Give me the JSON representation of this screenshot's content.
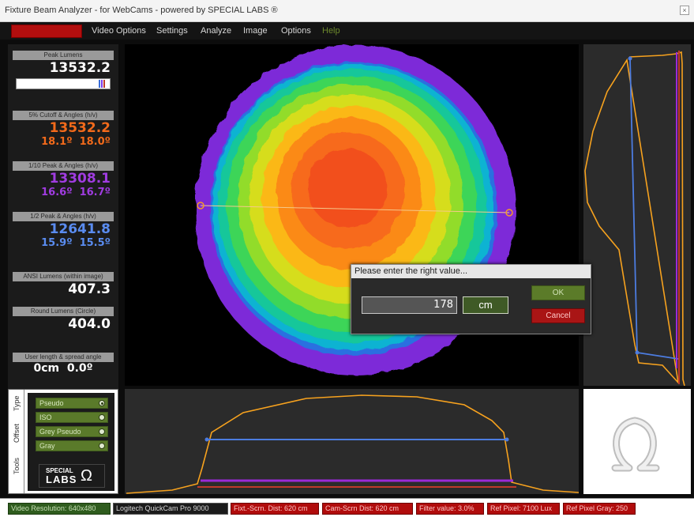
{
  "window": {
    "title": "Fixture Beam Analyzer - for WebCams - powered by SPECIAL LABS ®"
  },
  "menu": {
    "items": [
      {
        "label": "Video Options"
      },
      {
        "label": "Settings"
      },
      {
        "label": "Analyze"
      },
      {
        "label": "Image"
      },
      {
        "label": "Options"
      },
      {
        "label": "Help"
      }
    ]
  },
  "stats": {
    "peak_lumens": {
      "label": "Peak Lumens",
      "value": "13532.2"
    },
    "cutoff": {
      "label": "5% Cutoff & Angles (h/v)",
      "value": "13532.2",
      "h_angle": "18.1º",
      "v_angle": "18.0º"
    },
    "tenth_peak": {
      "label": "1/10 Peak & Angles (h/v)",
      "value": "13308.1",
      "h_angle": "16.6º",
      "v_angle": "16.7º"
    },
    "half_peak": {
      "label": "1/2 Peak & Angles (h/v)",
      "value": "12641.8",
      "h_angle": "15.9º",
      "v_angle": "15.5º"
    },
    "ansi": {
      "label": "ANSI Lumens (within image)",
      "value": "407.3"
    },
    "round": {
      "label": "Round Lumens (Circle)",
      "value": "404.0"
    },
    "user_length": {
      "label": "User length & spread angle",
      "length": "0cm",
      "angle": "0.0º"
    }
  },
  "tools": {
    "tabs": [
      {
        "label": "Type"
      },
      {
        "label": "Offset"
      },
      {
        "label": "Tools"
      }
    ],
    "options": [
      {
        "label": "Pseudo",
        "selected": true
      },
      {
        "label": "ISO",
        "selected": false
      },
      {
        "label": "Grey Pseudo",
        "selected": false
      },
      {
        "label": "Gray",
        "selected": false
      }
    ],
    "brand_small": "SPECIAL",
    "brand_large": "LABS"
  },
  "dialog": {
    "title": "Please enter the right value...",
    "input_value": "178",
    "unit": "cm",
    "ok": "OK",
    "cancel": "Cancel"
  },
  "status": {
    "resolution": "Video Resolution: 640x480",
    "camera": "Logitech QuickCam Pro 9000",
    "fixture_dist": "Fixt.-Scrn. Dist: 620 cm",
    "cam_dist": "Cam-Scrn Dist: 620 cm",
    "filter": "Filter value: 3.0%",
    "ref_pixel": "Ref Pixel: 7100 Lux",
    "ref_gray": "Ref Pixel Gray: 250"
  },
  "colors": {
    "accent_red": "#b20e0e",
    "accent_green": "#5b7b29",
    "profile_orange": "#f7a21e",
    "profile_blue": "#4c7ce0",
    "profile_purple": "#9b2ad8"
  }
}
